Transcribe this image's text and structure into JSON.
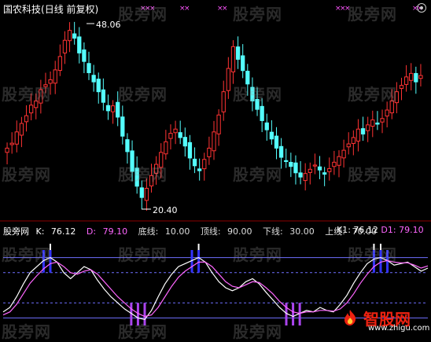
{
  "title": {
    "stock": "国农科技",
    "period": "(日线 前复权)"
  },
  "price_labels": {
    "high": "48.06",
    "low": "20.40"
  },
  "indicator": {
    "name": "股旁网",
    "k_label": "K:",
    "k_value": "76.12",
    "d_label": "D:",
    "d_value": "79.10",
    "bottom_label": "底线:",
    "bottom_value": "10.00",
    "top_label": "顶线:",
    "top_value": "90.00",
    "down_label": "下线:",
    "down_value": "30.00",
    "up_label": "上线:",
    "up_value": "70.00",
    "k1_label": "K1:",
    "k1_value": "76.12",
    "d1_label": "D1:",
    "d1_value": "79.10"
  },
  "watermark_text": "股旁网",
  "logo": {
    "brand": "智股网",
    "url": "www.zhigu.com"
  },
  "colors": {
    "up_candle": "#ff3333",
    "down_candle": "#54ffff",
    "k_line": "#ffffff",
    "d_line": "#ff66ff",
    "signal_top": "#3333ff",
    "signal_bottom": "#aa44ee",
    "guide_line": "#6f6fff"
  },
  "chart_data": [
    {
      "type": "candlestick",
      "title": "国农科技(日线 前复权)",
      "annotations": [
        {
          "label": "48.06",
          "kind": "high"
        },
        {
          "label": "20.40",
          "kind": "low"
        }
      ],
      "ylim": [
        20.4,
        48.06
      ],
      "close": [
        29.5,
        30.2,
        31.8,
        33.0,
        34.1,
        35.6,
        36.2,
        37.8,
        38.5,
        39.2,
        40.6,
        42.5,
        44.8,
        46.2,
        45.1,
        43.0,
        41.8,
        40.2,
        38.9,
        37.5,
        36.0,
        34.8,
        35.5,
        33.9,
        31.2,
        29.0,
        26.2,
        24.1,
        22.5,
        23.8,
        25.6,
        27.2,
        28.9,
        30.4,
        31.6,
        32.2,
        31.0,
        29.8,
        28.1,
        27.0,
        26.3,
        27.9,
        29.5,
        31.8,
        34.2,
        37.5,
        40.8,
        43.9,
        42.1,
        40.5,
        38.6,
        36.2,
        35.0,
        33.4,
        32.1,
        30.8,
        29.5,
        28.2,
        27.6,
        26.9,
        26.0,
        25.4,
        25.9,
        26.5,
        27.1,
        26.4,
        25.8,
        26.6,
        27.5,
        28.3,
        29.2,
        30.1,
        31.0,
        32.2,
        31.5,
        32.8,
        33.5,
        32.9,
        33.7,
        34.9,
        36.2,
        37.5,
        38.4,
        39.6,
        40.1,
        38.9,
        39.8
      ]
    },
    {
      "type": "line",
      "series": [
        {
          "name": "K",
          "values": [
            18,
            24,
            38,
            55,
            70,
            78,
            86,
            90,
            84,
            70,
            62,
            70,
            78,
            74,
            60,
            48,
            38,
            30,
            22,
            16,
            10,
            8,
            20,
            38,
            55,
            68,
            78,
            82,
            86,
            90,
            84,
            70,
            58,
            50,
            46,
            50,
            58,
            62,
            55,
            44,
            34,
            24,
            16,
            12,
            16,
            20,
            18,
            24,
            20,
            18,
            28,
            40,
            56,
            70,
            82,
            88,
            90,
            86,
            80,
            82,
            84,
            78,
            72,
            76
          ]
        },
        {
          "name": "D",
          "values": [
            14,
            18,
            28,
            42,
            56,
            66,
            75,
            82,
            84,
            78,
            70,
            68,
            72,
            74,
            68,
            58,
            48,
            38,
            30,
            22,
            16,
            12,
            14,
            24,
            38,
            52,
            64,
            72,
            78,
            84,
            84,
            78,
            68,
            58,
            52,
            50,
            54,
            58,
            57,
            50,
            42,
            32,
            24,
            18,
            16,
            18,
            18,
            20,
            20,
            19,
            22,
            30,
            42,
            56,
            68,
            78,
            84,
            86,
            84,
            83,
            83,
            80,
            76,
            79
          ]
        }
      ],
      "ylim": [
        0,
        100
      ],
      "reference_lines": [
        10,
        30,
        70,
        90
      ]
    }
  ]
}
